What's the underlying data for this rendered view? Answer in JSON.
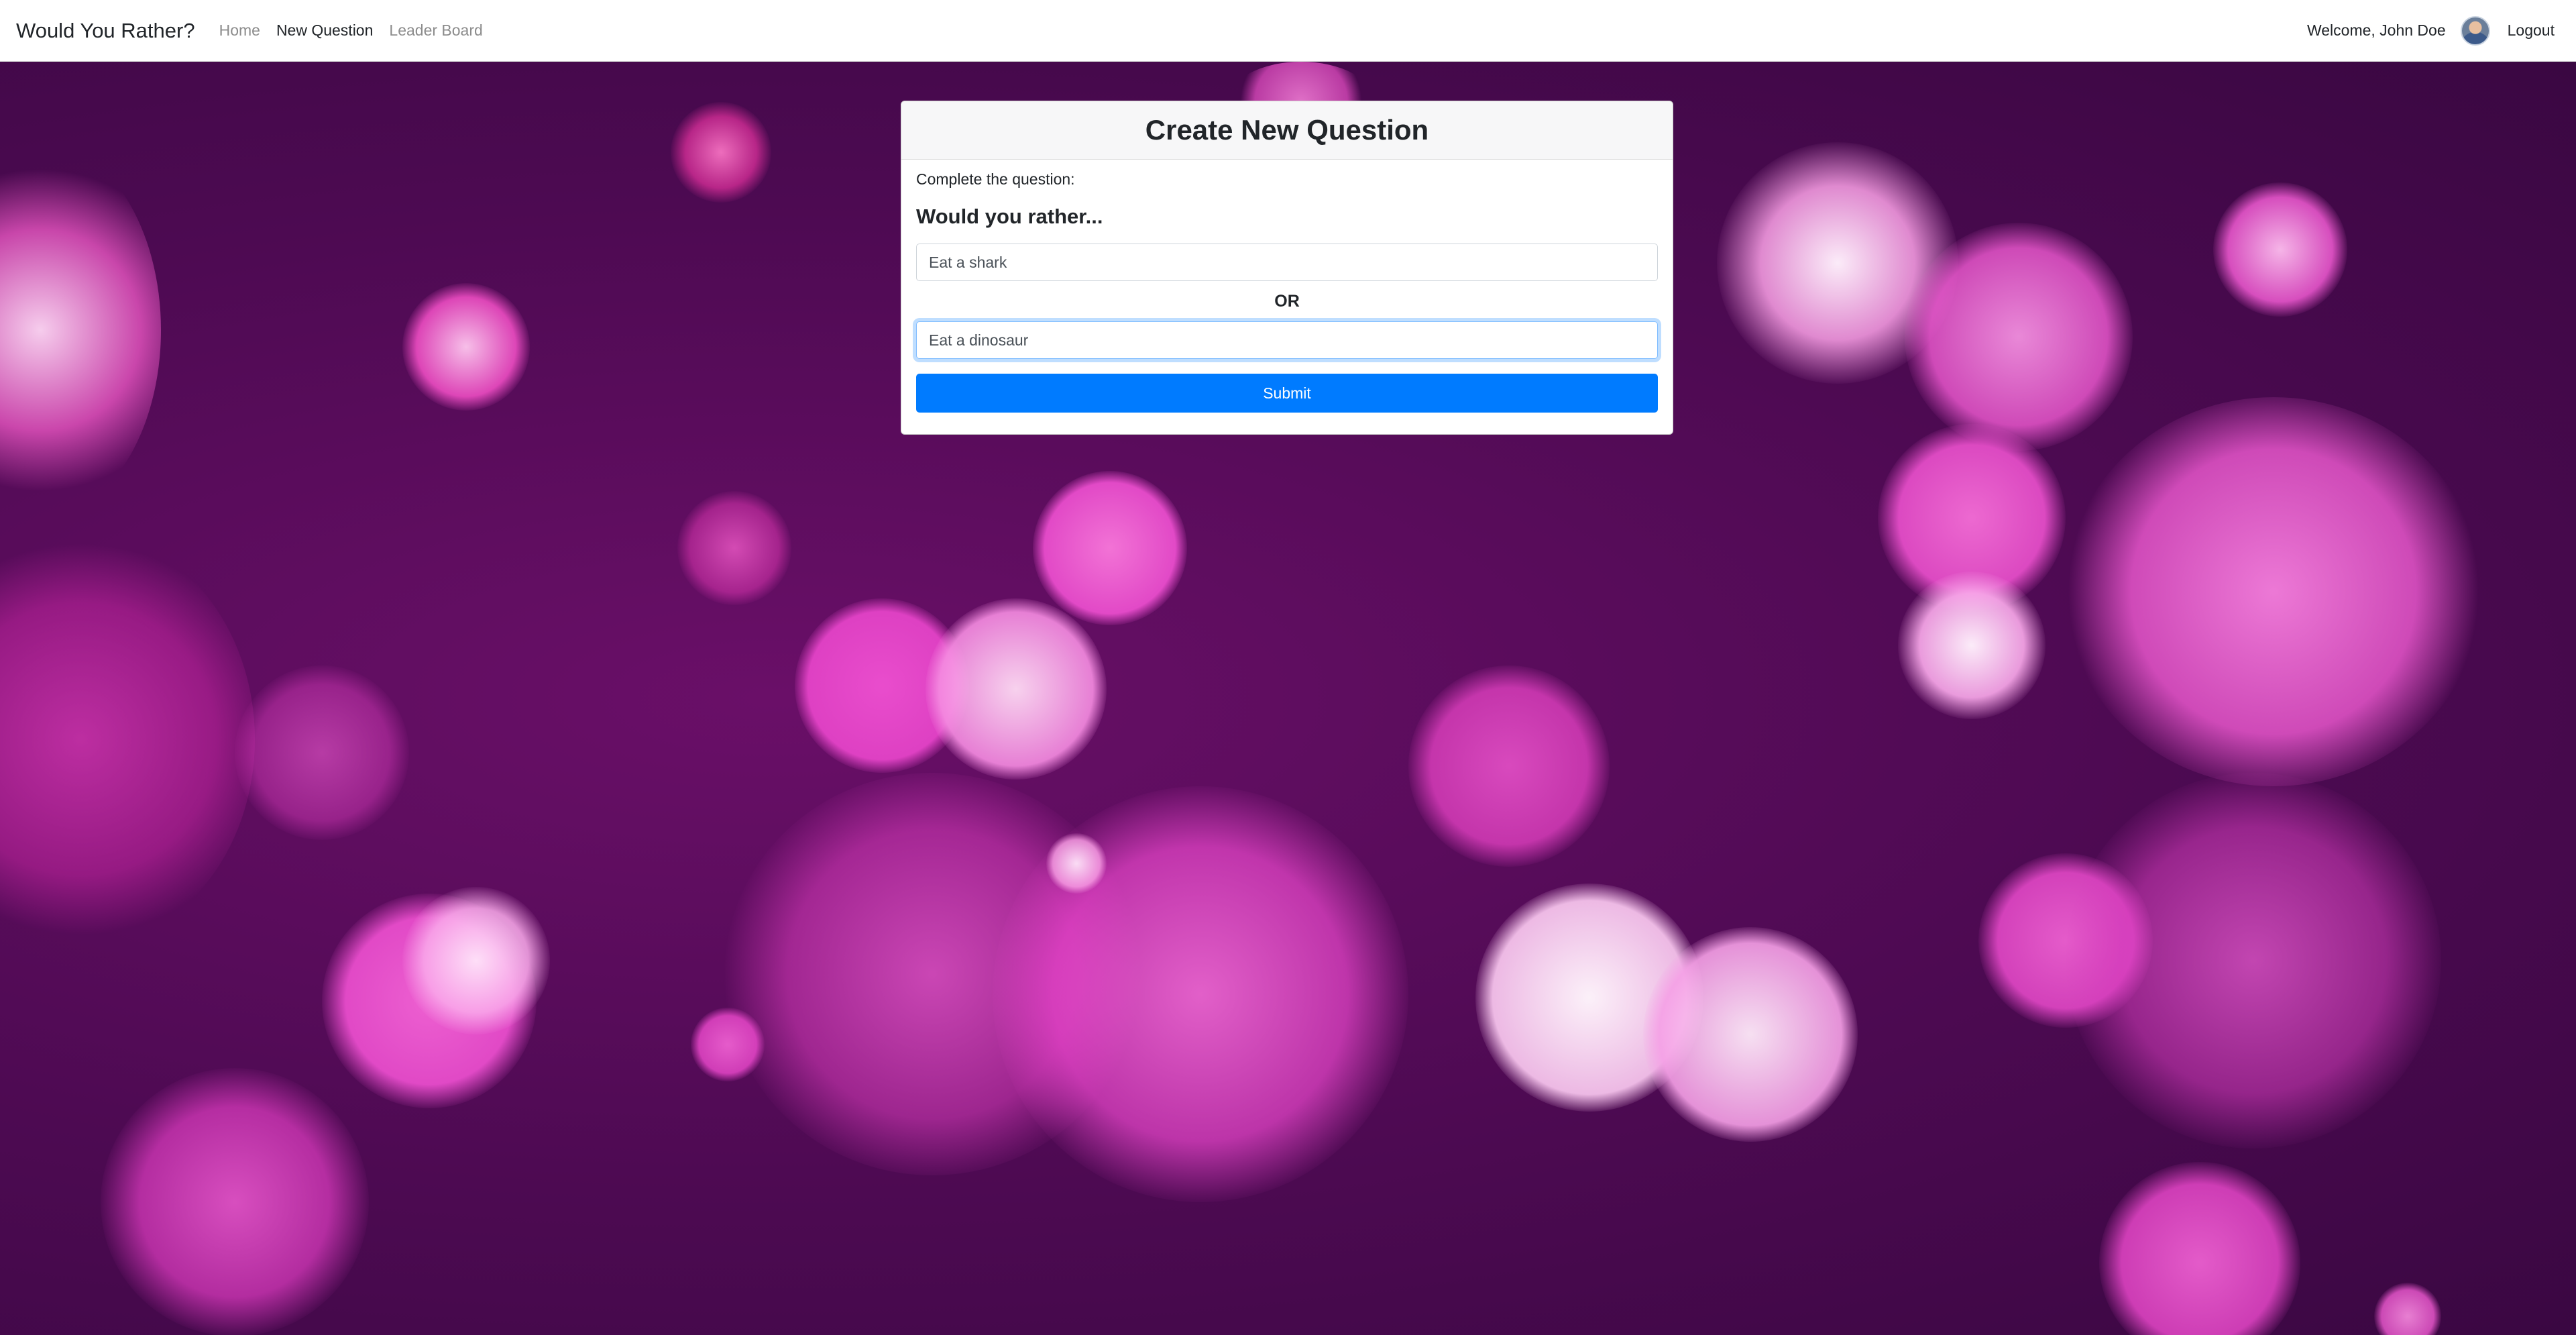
{
  "navbar": {
    "brand": "Would You Rather?",
    "links": [
      {
        "label": "Home",
        "active": false
      },
      {
        "label": "New Question",
        "active": true
      },
      {
        "label": "Leader Board",
        "active": false
      }
    ],
    "welcome": "Welcome, John Doe",
    "logout_label": "Logout"
  },
  "card": {
    "title": "Create New Question",
    "instruction": "Complete the question:",
    "subtitle": "Would you rather...",
    "option_one_value": "Eat a shark",
    "or_label": "OR",
    "option_two_value": "Eat a dinosaur",
    "submit_label": "Submit"
  },
  "colors": {
    "primary": "#007bff",
    "background_purple": "#4a0a4f",
    "bokeh_pink": "#f04ec8"
  }
}
